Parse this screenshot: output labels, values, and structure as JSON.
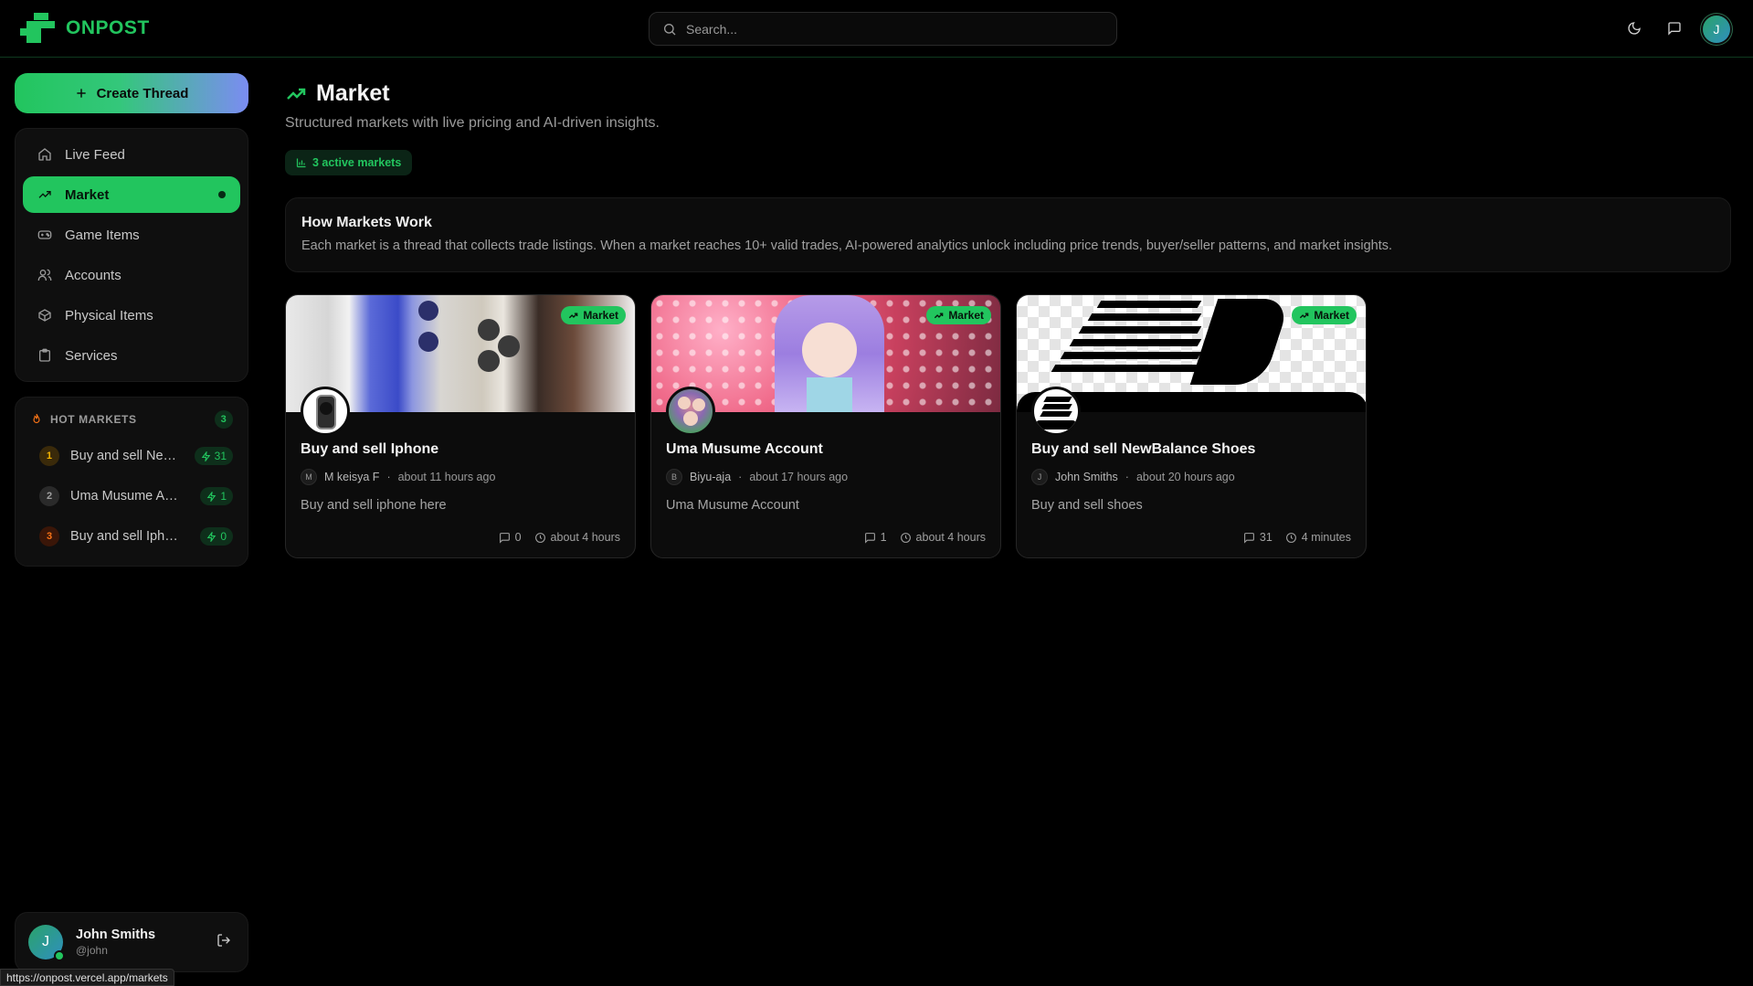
{
  "app": {
    "name": "ONPOST"
  },
  "search": {
    "placeholder": "Search..."
  },
  "header": {
    "avatar_initial": "J"
  },
  "sidebar": {
    "create_label": "Create Thread",
    "nav": [
      {
        "label": "Live Feed",
        "icon": "home-icon"
      },
      {
        "label": "Market",
        "icon": "trending-up-icon",
        "active": true
      },
      {
        "label": "Game Items",
        "icon": "gamepad-icon"
      },
      {
        "label": "Accounts",
        "icon": "users-icon"
      },
      {
        "label": "Physical Items",
        "icon": "package-icon"
      },
      {
        "label": "Services",
        "icon": "clipboard-icon"
      }
    ],
    "hot": {
      "title": "HOT MARKETS",
      "count": "3",
      "items": [
        {
          "rank": "1",
          "label": "Buy and sell NewBalance Shoes",
          "count": "31"
        },
        {
          "rank": "2",
          "label": "Uma Musume Account",
          "count": "1"
        },
        {
          "rank": "3",
          "label": "Buy and sell Iphone",
          "count": "0"
        }
      ]
    },
    "user": {
      "initial": "J",
      "name": "John Smiths",
      "handle": "@john"
    }
  },
  "main": {
    "title": "Market",
    "subtitle": "Structured markets with live pricing and AI-driven insights.",
    "active_pill": "3 active markets",
    "how": {
      "title": "How Markets Work",
      "text": "Each market is a thread that collects trade listings. When a market reaches 10+ valid trades, AI-powered analytics unlock including price trends, buyer/seller patterns, and market insights."
    },
    "cards": [
      {
        "tag": "Market",
        "title": "Buy and sell Iphone",
        "author_initial": "M",
        "author": "M keisya F",
        "time": "about 11 hours ago",
        "desc": "Buy and sell iphone here",
        "comments": "0",
        "activity": "about 4 hours"
      },
      {
        "tag": "Market",
        "title": "Uma Musume Account",
        "author_initial": "B",
        "author": "Biyu-aja",
        "time": "about 17 hours ago",
        "desc": "Uma Musume Account",
        "comments": "1",
        "activity": "about 4 hours"
      },
      {
        "tag": "Market",
        "title": "Buy and sell NewBalance Shoes",
        "author_initial": "J",
        "author": "John Smiths",
        "time": "about 20 hours ago",
        "desc": "Buy and sell shoes",
        "comments": "31",
        "activity": "4 minutes"
      }
    ]
  },
  "status_url": "https://onpost.vercel.app/markets",
  "colors": {
    "accent": "#22c55e",
    "background": "#000000",
    "panel": "#0f0f0f"
  }
}
